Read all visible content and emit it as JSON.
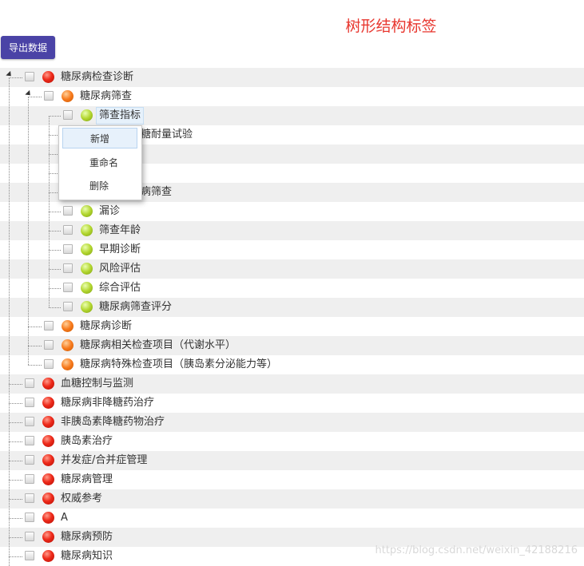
{
  "title": "树形结构标签",
  "export_button": "导出数据",
  "tree_nodes": [
    {
      "label": "糖尿病检查诊断",
      "color": "red"
    },
    {
      "label": "糖尿病筛查",
      "color": "orange"
    },
    {
      "label": "筛查指标",
      "color": "green"
    },
    {
      "label": "口服葡萄糖耐量试验",
      "color": "green"
    },
    {
      "label": "",
      "color": "green"
    },
    {
      "label": "",
      "color": "green"
    },
    {
      "label": "妊娠糖尿病筛查",
      "color": "green"
    },
    {
      "label": "漏诊",
      "color": "green"
    },
    {
      "label": "筛查年龄",
      "color": "green"
    },
    {
      "label": "早期诊断",
      "color": "green"
    },
    {
      "label": "风险评估",
      "color": "green"
    },
    {
      "label": "综合评估",
      "color": "green"
    },
    {
      "label": "糖尿病筛查评分",
      "color": "green"
    },
    {
      "label": "糖尿病诊断",
      "color": "orange"
    },
    {
      "label": "糖尿病相关检查项目（代谢水平）",
      "color": "orange"
    },
    {
      "label": "糖尿病特殊检查项目（胰岛素分泌能力等）",
      "color": "orange"
    },
    {
      "label": "血糖控制与监测",
      "color": "red"
    },
    {
      "label": "糖尿病非降糖药治疗",
      "color": "red"
    },
    {
      "label": "非胰岛素降糖药物治疗",
      "color": "red"
    },
    {
      "label": "胰岛素治疗",
      "color": "red"
    },
    {
      "label": "并发症/合并症管理",
      "color": "red"
    },
    {
      "label": "糖尿病管理",
      "color": "red"
    },
    {
      "label": "权威参考",
      "color": "red"
    },
    {
      "label": "A",
      "color": "red"
    },
    {
      "label": "糖尿病预防",
      "color": "red"
    },
    {
      "label": "糖尿病知识",
      "color": "red"
    }
  ],
  "context_menu": {
    "items": [
      "新增",
      "重命名",
      "删除"
    ],
    "highlighted": "新增"
  },
  "watermark": "https://blog.csdn.net/weixin_42188216",
  "colors": {
    "title": "#e8372f",
    "button": "#4a43a6",
    "red_dot": "#ee2a1a",
    "orange_dot": "#f7791b",
    "green_dot": "#b2d62f"
  }
}
